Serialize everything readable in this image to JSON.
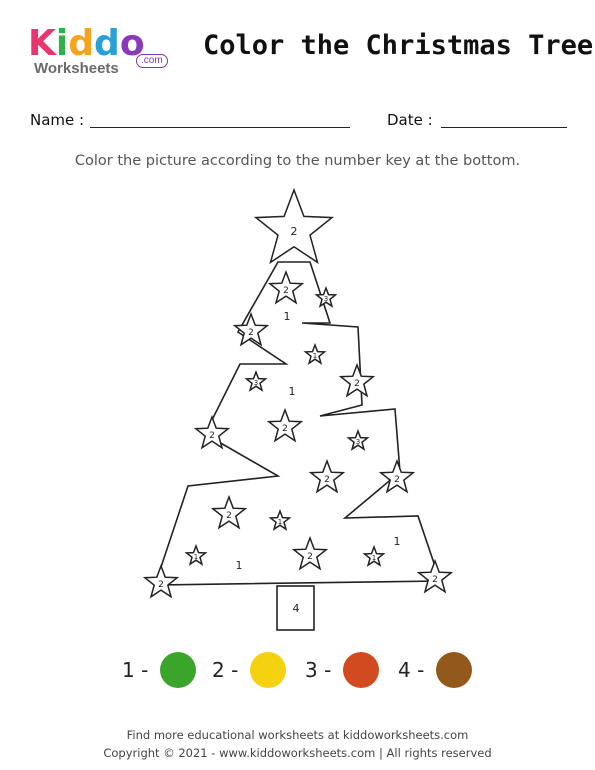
{
  "logo": {
    "letters": [
      "K",
      "i",
      "d",
      "d",
      "o"
    ],
    "letter_colors": [
      "#e8356d",
      "#2fb04b",
      "#f4a41d",
      "#2a9fd8",
      "#8a3ab9"
    ],
    "worksheets": "Worksheets",
    "com": ".com"
  },
  "title": "Color the Christmas Tree",
  "fields": {
    "name_label": "Name :",
    "date_label": "Date :"
  },
  "instruction": "Color the picture according to the number key at the bottom.",
  "tree": {
    "top_star_label": "2",
    "region_labels": [
      "1",
      "1",
      "1",
      "1"
    ],
    "trunk_label": "4",
    "stars": [
      {
        "label": "2",
        "size": "large"
      },
      {
        "label": "3",
        "size": "small"
      },
      {
        "label": "1",
        "size": "small"
      },
      {
        "label": "2",
        "size": "large"
      },
      {
        "label": "2",
        "size": "large"
      },
      {
        "label": "3",
        "size": "small"
      },
      {
        "label": "2",
        "size": "large"
      },
      {
        "label": "2",
        "size": "large"
      },
      {
        "label": "3",
        "size": "small"
      },
      {
        "label": "2",
        "size": "large"
      },
      {
        "label": "2",
        "size": "large"
      },
      {
        "label": "2",
        "size": "large"
      },
      {
        "label": "2",
        "size": "large"
      },
      {
        "label": "1",
        "size": "small"
      },
      {
        "label": "2",
        "size": "large"
      },
      {
        "label": "1",
        "size": "small"
      },
      {
        "label": "1",
        "size": "small"
      },
      {
        "label": "2",
        "size": "large"
      },
      {
        "label": "2",
        "size": "large"
      }
    ]
  },
  "key": [
    {
      "number": "1 -",
      "color": "#3aa52a"
    },
    {
      "number": "2 -",
      "color": "#f5d20f"
    },
    {
      "number": "3 -",
      "color": "#d24a1f"
    },
    {
      "number": "4 -",
      "color": "#93591a"
    }
  ],
  "footer": {
    "line1": "Find more educational worksheets at kiddoworksheets.com",
    "line2": "Copyright © 2021 - www.kiddoworksheets.com  |  All rights reserved"
  }
}
